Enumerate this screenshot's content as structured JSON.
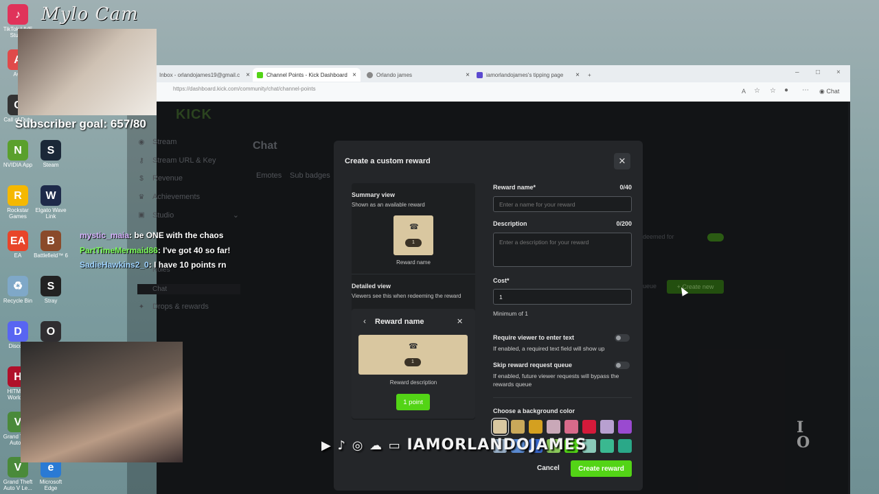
{
  "stream": {
    "cam_title": "Mylo Cam",
    "subscriber_goal": "Subscriber goal: 657/80",
    "chat": [
      {
        "user": "mystic_maia",
        "user_color": "#d8b4ff",
        "message": ": be ONE with the chaos"
      },
      {
        "user": "PartTimeMermaid86",
        "user_color": "#7cfc5a",
        "message": ": I've got 40 so far!"
      },
      {
        "user": "SadieHawkins2_0",
        "user_color": "#9fd3ff",
        "message": ": I have 10 points rn"
      }
    ],
    "social_handle": "IAMORLANDOJAMES"
  },
  "desktop": {
    "icons": [
      {
        "label": "TikTok LIVE Studio",
        "color": "#e0335a",
        "glyph": "♪"
      },
      {
        "label": "Avy",
        "color": "#e04a4a",
        "glyph": "A"
      },
      {
        "label": "Call of Duty",
        "color": "#333333",
        "glyph": "C"
      },
      {
        "label": "NVIDIA App",
        "color": "#5aa02c",
        "glyph": "N"
      },
      {
        "label": "Steam",
        "color": "#1b2838",
        "glyph": "S"
      },
      {
        "label": "Rockstar Games",
        "color": "#f5b800",
        "glyph": "R"
      },
      {
        "label": "Elgato Wave Link",
        "color": "#1e2a4a",
        "glyph": "W"
      },
      {
        "label": "EA",
        "color": "#e8452a",
        "glyph": "EA"
      },
      {
        "label": "Battlefield™ 6",
        "color": "#8a4a2a",
        "glyph": "B"
      },
      {
        "label": "Recycle Bin",
        "color": "#7fa8c8",
        "glyph": "♻"
      },
      {
        "label": "Stray",
        "color": "#222222",
        "glyph": "S"
      },
      {
        "label": "Discord",
        "color": "#5865f2",
        "glyph": "D"
      },
      {
        "label": "OBS",
        "color": "#302e31",
        "glyph": "O"
      },
      {
        "label": "HITMAN World of",
        "color": "#b0102a",
        "glyph": "H"
      },
      {
        "label": "Grand Theft Auto V",
        "color": "#4a8a3a",
        "glyph": "V"
      },
      {
        "label": "Grand Theft Auto V Le...",
        "color": "#4a8a3a",
        "glyph": "V"
      },
      {
        "label": "Microsoft Edge",
        "color": "#2a7ad4",
        "glyph": "e"
      }
    ]
  },
  "browser": {
    "tabs": [
      {
        "label": "Inbox - orlandojames19@gmail.c",
        "active": false
      },
      {
        "label": "Channel Points - Kick Dashboard",
        "active": true
      },
      {
        "label": "Orlando james",
        "active": false
      },
      {
        "label": "iamorlandojames's tipping page",
        "active": false
      }
    ],
    "url": "https://dashboard.kick.com/community/chat/channel-points",
    "chat_button": "Chat"
  },
  "dashboard": {
    "logo": "KICK",
    "sidebar": [
      {
        "label": "Stream",
        "icon": "radio-icon"
      },
      {
        "label": "Stream URL & Key",
        "icon": "key-icon"
      },
      {
        "label": "Revenue",
        "icon": "dollar-icon"
      },
      {
        "label": "Achievements",
        "icon": "trophy-icon"
      },
      {
        "label": "Studio",
        "icon": "studio-icon"
      },
      {
        "label": "Roles",
        "icon": ""
      },
      {
        "label": "Chat",
        "icon": ""
      },
      {
        "label": "Drops & rewards",
        "icon": "gift-icon"
      }
    ],
    "page_title": "Chat",
    "tabs": [
      "Emotes",
      "Sub badges"
    ],
    "bg_text_redeemed": "deemed for",
    "bg_text_queue": "ueue",
    "bg_create_new": "Create new"
  },
  "modal": {
    "title": "Create a custom reward",
    "summary_title": "Summary view",
    "summary_sub": "Shown as an available reward",
    "reward_name_preview": "Reward name",
    "cost_pill": "1",
    "detailed_title": "Detailed view",
    "detailed_sub": "Viewers see this when redeeming the reward",
    "detailed_header": "Reward name",
    "reward_description_preview": "Reward description",
    "point_button": "1 point",
    "reward_name_label": "Reward name*",
    "reward_name_count": "0/40",
    "reward_name_placeholder": "Enter a name for your reward",
    "description_label": "Description",
    "description_count": "0/200",
    "description_placeholder": "Enter a description for your reward",
    "cost_label": "Cost*",
    "cost_value": "1",
    "cost_hint": "Minimum of 1",
    "require_text_label": "Require viewer to enter text",
    "require_text_hint": "If enabled, a required text field will show up",
    "skip_queue_label": "Skip reward request queue",
    "skip_queue_hint": "If enabled, future viewer requests will bypass the rewards queue",
    "bg_color_label": "Choose a background color",
    "colors_row1": [
      "#d9c7a0",
      "#c9a85a",
      "#d4a020",
      "#c9a8b8",
      "#d86a8a",
      "#d41a3a",
      "#b8a0d0",
      "#9a4ad0"
    ],
    "colors_row2": [
      "#9ab0c8",
      "#5a8ad0",
      "#3a6ad0",
      "#8ac85a",
      "#53d416",
      "#8ac8b8",
      "#3ab890",
      "#2aa888"
    ],
    "cancel": "Cancel",
    "create": "Create reward"
  }
}
